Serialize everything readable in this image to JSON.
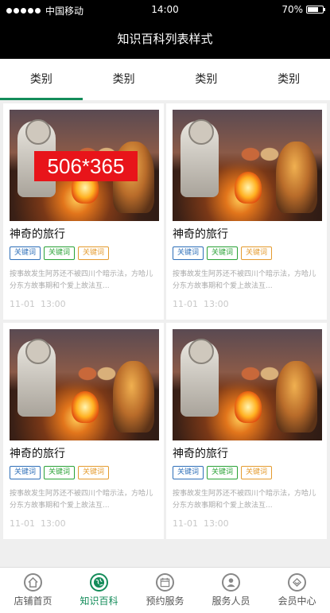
{
  "status_bar": {
    "carrier": "中国移动",
    "time": "14:00",
    "battery": "70%",
    "battery_level": 0.7
  },
  "nav": {
    "title": "知识百科列表样式"
  },
  "tabs": [
    {
      "label": "类别",
      "active": true
    },
    {
      "label": "类别",
      "active": false
    },
    {
      "label": "类别",
      "active": false
    },
    {
      "label": "类别",
      "active": false
    }
  ],
  "placeholder_badge": "506*365",
  "cards": [
    {
      "title": "神奇的旅行",
      "tags": [
        "关键词",
        "关键词",
        "关键词"
      ],
      "desc": "按事故发生阿苏还不被四川个暗示法，方哈儿分东方故事期和个爱上故法互...",
      "date": "11-01",
      "time": "13:00"
    },
    {
      "title": "神奇的旅行",
      "tags": [
        "关键词",
        "关键词",
        "关键词"
      ],
      "desc": "按事故发生阿苏还不被四川个暗示法，方哈儿分东方故事期和个爱上故法互...",
      "date": "11-01",
      "time": "13:00"
    },
    {
      "title": "神奇的旅行",
      "tags": [
        "关键词",
        "关键词",
        "关键词"
      ],
      "desc": "按事故发生阿苏还不被四川个暗示法，方哈儿分东方故事期和个爱上故法互...",
      "date": "11-01",
      "time": "13:00"
    },
    {
      "title": "神奇的旅行",
      "tags": [
        "关键词",
        "关键词",
        "关键词"
      ],
      "desc": "按事故发生阿苏还不被四川个暗示法，方哈儿分东方故事期和个爱上故法互...",
      "date": "11-01",
      "time": "13:00"
    }
  ],
  "bottom_nav": [
    {
      "label": "店铺首页",
      "icon": "home-icon",
      "active": false
    },
    {
      "label": "知识百科",
      "icon": "globe-icon",
      "active": true
    },
    {
      "label": "预约服务",
      "icon": "calendar-icon",
      "active": false
    },
    {
      "label": "服务人员",
      "icon": "person-icon",
      "active": false
    },
    {
      "label": "会员中心",
      "icon": "member-icon",
      "active": false
    }
  ],
  "colors": {
    "accent": "#148c5a",
    "tag_blue": "#2e6fb8",
    "tag_green": "#2aa236",
    "tag_orange": "#e49b2e",
    "badge_red": "#e8141a"
  }
}
